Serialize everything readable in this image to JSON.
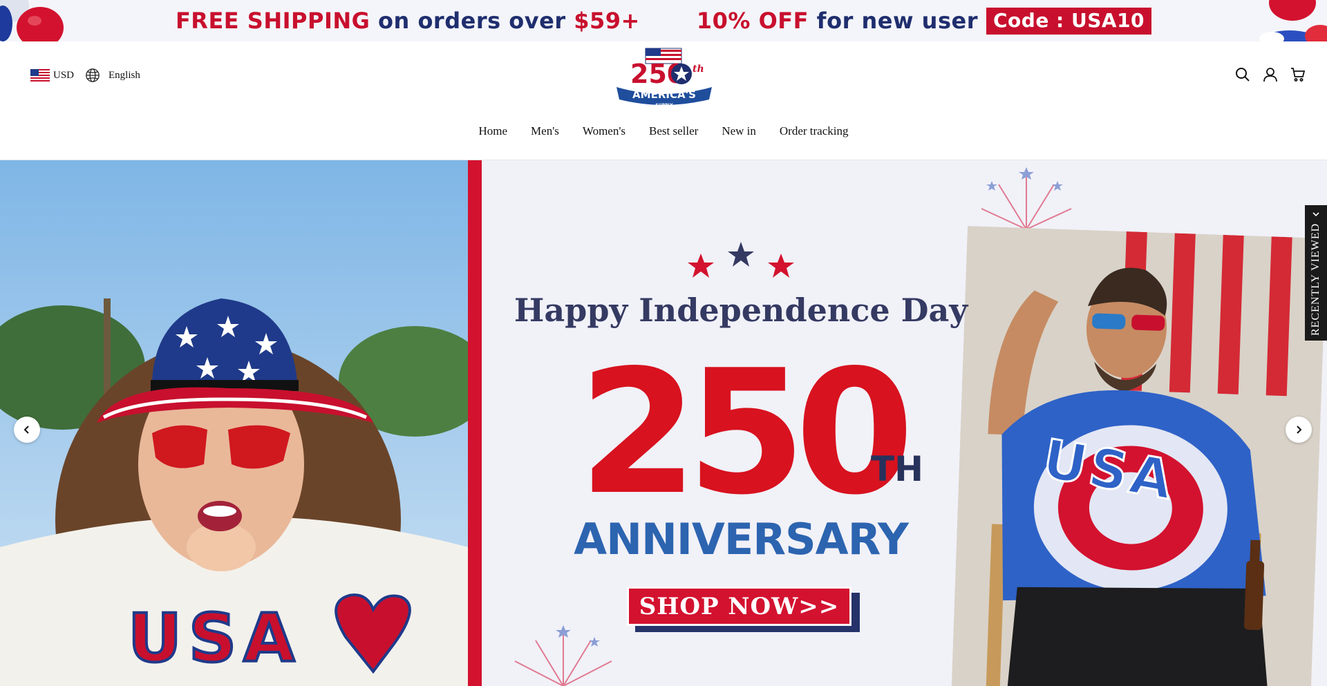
{
  "announcement": {
    "free_shipping": "FREE SHIPPING",
    "on_orders_over": "on orders over",
    "threshold": "$59+",
    "discount": "10% OFF",
    "for_new_user": "for new user",
    "code": "Code : USA10"
  },
  "header": {
    "currency": "USD",
    "language": "English",
    "logo": {
      "number": "250",
      "suffix": "th",
      "banner": "AMERICA'S",
      "tagline": "SUPPLY"
    },
    "icons": [
      "search-icon",
      "account-icon",
      "cart-icon"
    ]
  },
  "nav": {
    "items": [
      "Home",
      "Men's",
      "Women's",
      "Best seller",
      "New in",
      "Order tracking"
    ]
  },
  "hero": {
    "title": "Happy Independence Day",
    "number": "250",
    "suffix": "TH",
    "subtitle": "ANNIVERSARY",
    "cta": "SHOP NOW>>",
    "left_shirt_text": "USA",
    "right_shirt_text": "USA"
  },
  "recently_viewed": "RECENTLY VIEWED",
  "colors": {
    "red": "#c8102e",
    "navy": "#1f2e6e",
    "anniversary_blue": "#2c64b0"
  }
}
